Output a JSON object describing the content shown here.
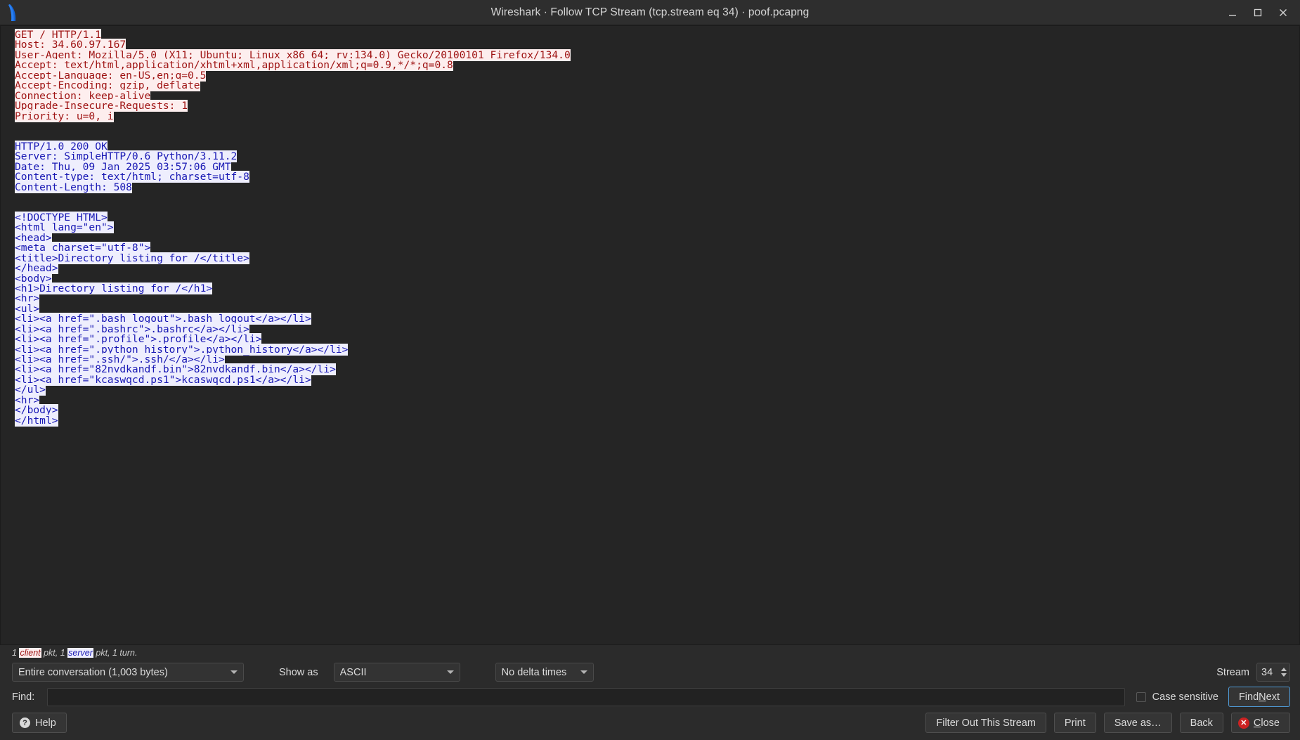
{
  "window": {
    "title": "Wireshark · Follow TCP Stream (tcp.stream eq 34) · poof.pcapng",
    "minimize_icon": "minimize-icon",
    "maximize_icon": "maximize-icon",
    "close_icon": "close-icon"
  },
  "stream": {
    "lines": [
      {
        "text": "GET / HTTP/1.1",
        "role": "client"
      },
      {
        "text": "Host: 34.60.97.167",
        "role": "client"
      },
      {
        "text": "User-Agent: Mozilla/5.0 (X11; Ubuntu; Linux x86_64; rv:134.0) Gecko/20100101 Firefox/134.0",
        "role": "client"
      },
      {
        "text": "Accept: text/html,application/xhtml+xml,application/xml;q=0.9,*/*;q=0.8",
        "role": "client"
      },
      {
        "text": "Accept-Language: en-US,en;q=0.5",
        "role": "client"
      },
      {
        "text": "Accept-Encoding: gzip, deflate",
        "role": "client"
      },
      {
        "text": "Connection: keep-alive",
        "role": "client"
      },
      {
        "text": "Upgrade-Insecure-Requests: 1",
        "role": "client"
      },
      {
        "text": "Priority: u=0, i",
        "role": "client"
      },
      {
        "text": "",
        "role": "blank"
      },
      {
        "text": "",
        "role": "blank"
      },
      {
        "text": "HTTP/1.0 200 OK",
        "role": "server"
      },
      {
        "text": "Server: SimpleHTTP/0.6 Python/3.11.2",
        "role": "server"
      },
      {
        "text": "Date: Thu, 09 Jan 2025 03:57:06 GMT",
        "role": "server"
      },
      {
        "text": "Content-type: text/html; charset=utf-8",
        "role": "server"
      },
      {
        "text": "Content-Length: 508",
        "role": "server"
      },
      {
        "text": "",
        "role": "blank"
      },
      {
        "text": "",
        "role": "blank"
      },
      {
        "text": "<!DOCTYPE HTML>",
        "role": "server"
      },
      {
        "text": "<html lang=\"en\">",
        "role": "server"
      },
      {
        "text": "<head>",
        "role": "server"
      },
      {
        "text": "<meta charset=\"utf-8\">",
        "role": "server"
      },
      {
        "text": "<title>Directory listing for /</title>",
        "role": "server"
      },
      {
        "text": "</head>",
        "role": "server"
      },
      {
        "text": "<body>",
        "role": "server"
      },
      {
        "text": "<h1>Directory listing for /</h1>",
        "role": "server"
      },
      {
        "text": "<hr>",
        "role": "server"
      },
      {
        "text": "<ul>",
        "role": "server"
      },
      {
        "text": "<li><a href=\".bash_logout\">.bash_logout</a></li>",
        "role": "server"
      },
      {
        "text": "<li><a href=\".bashrc\">.bashrc</a></li>",
        "role": "server"
      },
      {
        "text": "<li><a href=\".profile\">.profile</a></li>",
        "role": "server"
      },
      {
        "text": "<li><a href=\".python_history\">.python_history</a></li>",
        "role": "server"
      },
      {
        "text": "<li><a href=\".ssh/\">.ssh/</a></li>",
        "role": "server"
      },
      {
        "text": "<li><a href=\"82nvdkandf.bin\">82nvdkandf.bin</a></li>",
        "role": "server"
      },
      {
        "text": "<li><a href=\"kcaswqcd.ps1\">kcaswqcd.ps1</a></li>",
        "role": "server"
      },
      {
        "text": "</ul>",
        "role": "server"
      },
      {
        "text": "<hr>",
        "role": "server"
      },
      {
        "text": "</body>",
        "role": "server"
      },
      {
        "text": "</html>",
        "role": "server"
      }
    ]
  },
  "status": {
    "prefix": "1 ",
    "client_word": "client",
    "middle": " pkt, 1 ",
    "server_word": "server",
    "suffix": " pkt, 1 turn."
  },
  "controls": {
    "conversation_value": "Entire conversation (1,003 bytes)",
    "show_as_label": "Show as",
    "show_as_value": "ASCII",
    "delta_value": "No delta times",
    "stream_label": "Stream",
    "stream_value": "34"
  },
  "find": {
    "label": "Find:",
    "value": "",
    "placeholder": "",
    "case_sensitive_label": "Case sensitive",
    "case_sensitive_checked": false,
    "find_next_prefix": "Find ",
    "find_next_accel": "N",
    "find_next_suffix": "ext"
  },
  "buttons": {
    "help": "Help",
    "help_glyph": "?",
    "filter_out": "Filter Out This Stream",
    "print": "Print",
    "save_as": "Save as…",
    "back": "Back",
    "close_prefix": "",
    "close_accel": "C",
    "close_suffix": "lose",
    "close_glyph": "✕"
  },
  "colors": {
    "client_text": "#9e1212",
    "client_bg": "#fdeeee",
    "server_text": "#1818b4",
    "server_bg": "#eeeefd",
    "window_bg": "#2b2b2b",
    "stream_bg": "#252525",
    "accent": "#4f9ad6",
    "close_red": "#cc2222"
  }
}
